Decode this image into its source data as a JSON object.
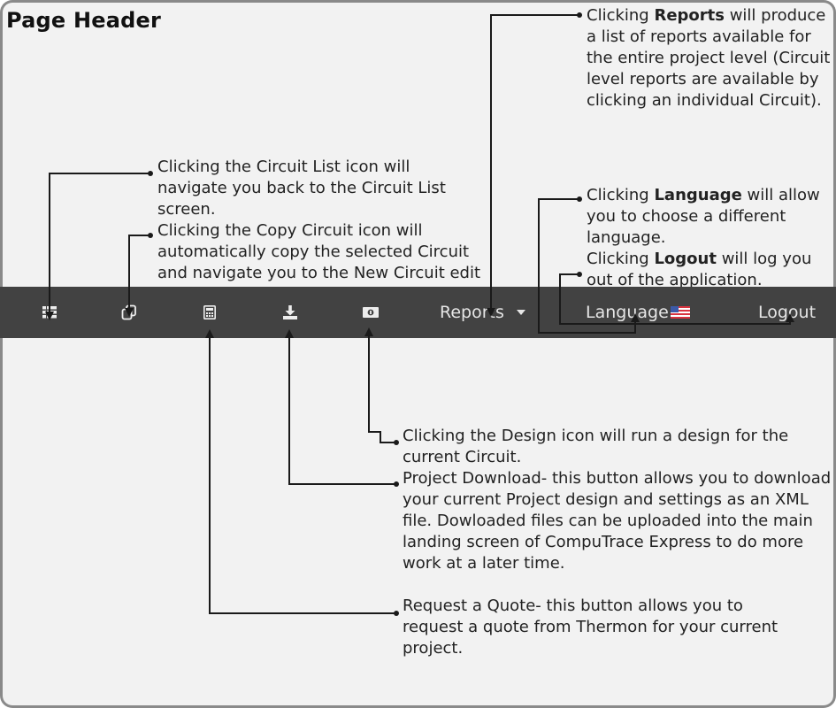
{
  "page_title": "Page Header",
  "navbar": {
    "icons": [
      {
        "name": "circuit-list-icon"
      },
      {
        "name": "copy-circuit-icon"
      },
      {
        "name": "request-quote-icon"
      },
      {
        "name": "project-download-icon"
      },
      {
        "name": "design-icon"
      }
    ],
    "reports_label": "Reports",
    "language_label": "Language",
    "logout_label": "Logout",
    "background_color": "#424242",
    "text_color": "#e6e6e6"
  },
  "notes": {
    "reports": {
      "pre": "Clicking ",
      "bold": "Reports",
      "post": " will produce a list of reports available for the entire project level (Circuit level reports are available by clicking an individual Circuit)."
    },
    "circuit_list": {
      "text": "Clicking the Circuit List icon will navigate you back to the Circuit List screen."
    },
    "copy_circuit": {
      "text": "Clicking the Copy Circuit icon will automatically copy the selected Circuit and navigate you to the New Circuit edit screen."
    },
    "language": {
      "pre": "Clicking ",
      "bold": "Language",
      "post": " will allow you to choose a different language."
    },
    "logout": {
      "pre": "Clicking ",
      "bold": "Logout",
      "post": " will log you out of the application."
    },
    "design": {
      "text": "Clicking the Design icon will run a design for the current Circuit."
    },
    "download": {
      "text": "Project Download- this button allows you to download your current Project design and settings as an XML file. Dowloaded files can be uploaded into the main landing screen of CompuTrace Express to do more work at a later time."
    },
    "quote": {
      "text": "Request a Quote- this button allows you to request a quote from Thermon for your current project."
    }
  }
}
